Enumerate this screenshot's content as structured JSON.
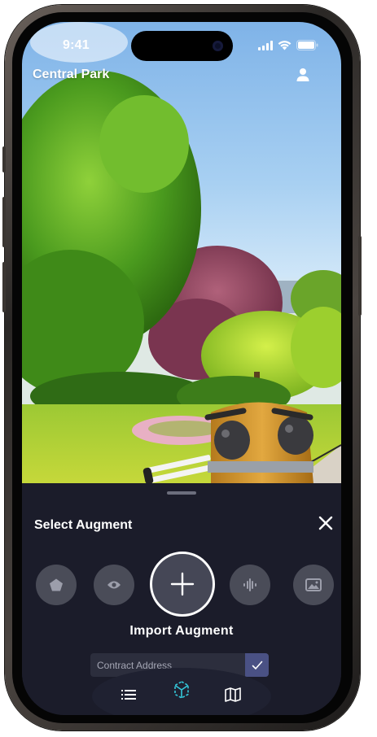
{
  "status_bar": {
    "time": "9:41",
    "icons": [
      "cellular-signal-icon",
      "wifi-icon",
      "battery-icon"
    ]
  },
  "location": {
    "title": "Central Park",
    "profile_icon": "person-icon"
  },
  "sheet": {
    "title": "Select Augment",
    "close_icon": "close-icon",
    "options": [
      {
        "name": "shape",
        "icon": "pentagon-icon"
      },
      {
        "name": "view",
        "icon": "eye-icon"
      },
      {
        "name": "import",
        "icon": "plus-icon"
      },
      {
        "name": "audio",
        "icon": "audio-wave-icon"
      },
      {
        "name": "image",
        "icon": "image-icon"
      }
    ],
    "import_label": "Import Augment",
    "contract": {
      "value": "",
      "placeholder": "Contract Address",
      "confirm_icon": "check-icon"
    }
  },
  "nav": {
    "items": [
      {
        "name": "list",
        "icon": "list-icon"
      },
      {
        "name": "ar",
        "icon": "ar-cube-icon",
        "active": true
      },
      {
        "name": "map",
        "icon": "map-icon"
      }
    ]
  },
  "colors": {
    "sheet_background": "#1b1c2a",
    "option_background": "#4a4c58",
    "accent_active": "#34c7d9",
    "confirm_button": "#4a5184"
  }
}
